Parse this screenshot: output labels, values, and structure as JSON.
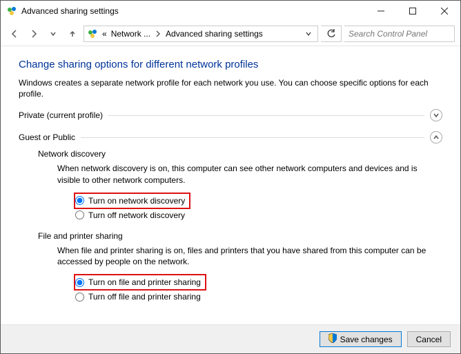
{
  "window": {
    "title": "Advanced sharing settings"
  },
  "breadcrumbs": {
    "root": "«",
    "lvl1": "Network ...",
    "lvl2": "Advanced sharing settings"
  },
  "search": {
    "placeholder": "Search Control Panel"
  },
  "heading": "Change sharing options for different network profiles",
  "description": "Windows creates a separate network profile for each network you use. You can choose specific options for each profile.",
  "sections": {
    "private": {
      "label": "Private (current profile)"
    },
    "guest": {
      "label": "Guest or Public"
    }
  },
  "network_discovery": {
    "title": "Network discovery",
    "desc": "When network discovery is on, this computer can see other network computers and devices and is visible to other network computers.",
    "on": "Turn on network discovery",
    "off": "Turn off network discovery"
  },
  "file_printer": {
    "title": "File and printer sharing",
    "desc": "When file and printer sharing is on, files and printers that you have shared from this computer can be accessed by people on the network.",
    "on": "Turn on file and printer sharing",
    "off": "Turn off file and printer sharing"
  },
  "buttons": {
    "save": "Save changes",
    "cancel": "Cancel"
  }
}
